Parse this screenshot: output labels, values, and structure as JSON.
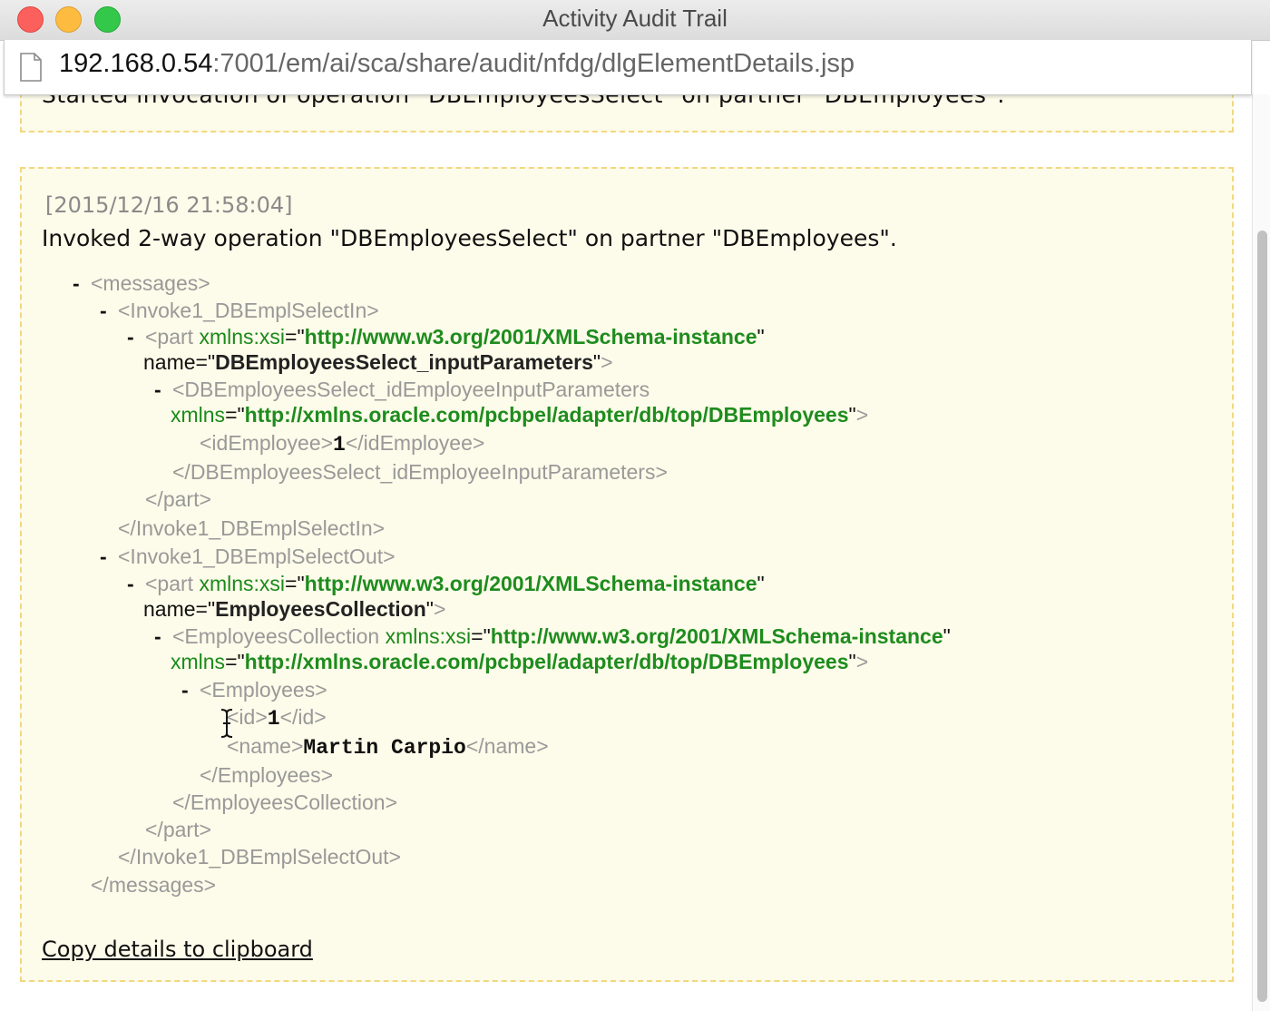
{
  "window": {
    "title": "Activity Audit Trail",
    "url_host": "192.168.0.54",
    "url_rest": ":7001/em/ai/sca/share/audit/nfdg/dlgElementDetails.jsp"
  },
  "event_prev": {
    "message_partial": "Started invocation of operation \"DBEmployeesSelect\" on partner \"DBEmployees\"."
  },
  "event": {
    "timestamp": "[2015/12/16 21:58:04]",
    "message": "Invoked 2-way operation \"DBEmployeesSelect\" on partner \"DBEmployees\".",
    "copy_link": "Copy details to clipboard"
  },
  "xml": {
    "messages_open": "<messages>",
    "messages_close": "</messages>",
    "in_open": "<Invoke1_DBEmplSelectIn>",
    "in_close": "</Invoke1_DBEmplSelectIn>",
    "out_open": "<Invoke1_DBEmplSelectOut>",
    "out_close": "</Invoke1_DBEmplSelectOut>",
    "part_open": "<part",
    "part_close": "</part>",
    "xmlns_xsi_attr": "xmlns:xsi",
    "xmlns_xsi_value": "http://www.w3.org/2001/XMLSchema-instance",
    "name_attr": "name",
    "part1_name": "DBEmployeesSelect_inputParameters",
    "part2_name": "EmployeesCollection",
    "params_open": "<DBEmployeesSelect_idEmployeeInputParameters",
    "params_close": "</DBEmployeesSelect_idEmployeeInputParameters>",
    "xmlns_attr": "xmlns",
    "xmlns_value": "http://xmlns.oracle.com/pcbpel/adapter/db/top/DBEmployees",
    "idEmployee_open": "<idEmployee>",
    "idEmployee_value": "1",
    "idEmployee_close": "</idEmployee>",
    "collection_open": "<EmployeesCollection",
    "collection_close": "</EmployeesCollection>",
    "employees_open": "<Employees>",
    "employees_close": "</Employees>",
    "id_open": "<id>",
    "id_value": "1",
    "id_close": "</id>",
    "name_open": "<name>",
    "name_value": "Martin Carpio",
    "name_close": "</name>"
  },
  "icons": {
    "page": "document-icon",
    "cursor": "text-cursor-icon"
  },
  "colors": {
    "panel_bg": "#fdfbe9",
    "panel_border": "#f3d77f",
    "xml_value_green": "#1e8c1e",
    "tag_gray": "#999999"
  }
}
